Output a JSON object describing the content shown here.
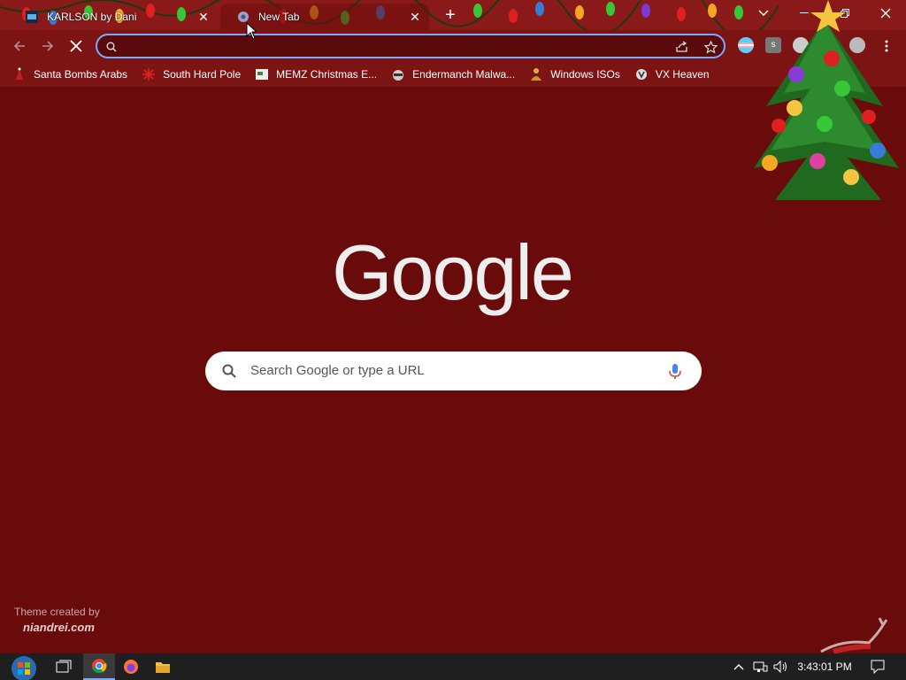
{
  "tabs": [
    {
      "title": "KARLSON by Dani",
      "favicon": "karlson-icon",
      "active": false
    },
    {
      "title": "New Tab",
      "favicon": "chrome-newtab-icon",
      "active": true
    }
  ],
  "window_controls": {
    "tab_search": "chevron-down-icon",
    "minimize": "minimize-icon",
    "restore": "restore-icon",
    "close": "close-icon"
  },
  "omnibox": {
    "value": "",
    "placeholder": ""
  },
  "bookmarks": [
    {
      "label": "Santa Bombs Arabs",
      "icon": "santa-icon"
    },
    {
      "label": "South Hard Pole",
      "icon": "red-snowflake-icon"
    },
    {
      "label": "MEMZ Christmas E...",
      "icon": "memz-icon"
    },
    {
      "label": "Endermanch Malwa...",
      "icon": "raccoon-icon"
    },
    {
      "label": "Windows ISOs",
      "icon": "person-icon"
    },
    {
      "label": "VX Heaven",
      "icon": "vx-icon"
    }
  ],
  "content": {
    "logo_text": "Google",
    "search_placeholder": "Search Google or type a URL",
    "theme_credit_line1": "Theme created by",
    "theme_credit_line2": "niandrei.com"
  },
  "taskbar": {
    "clock": "3:43:01 PM",
    "items": [
      "start-orb-icon",
      "task-view-icon",
      "chrome-icon",
      "firefox-icon",
      "file-explorer-icon"
    ],
    "tray": [
      "chevron-up-icon",
      "network-icon",
      "volume-icon",
      "notifications-icon"
    ]
  },
  "colors": {
    "page_background": "#6a0b0b",
    "toolbar": "#7c1414",
    "omnibox_focus_ring": "#7aa7ff",
    "taskbar": "#1f1f1f"
  }
}
